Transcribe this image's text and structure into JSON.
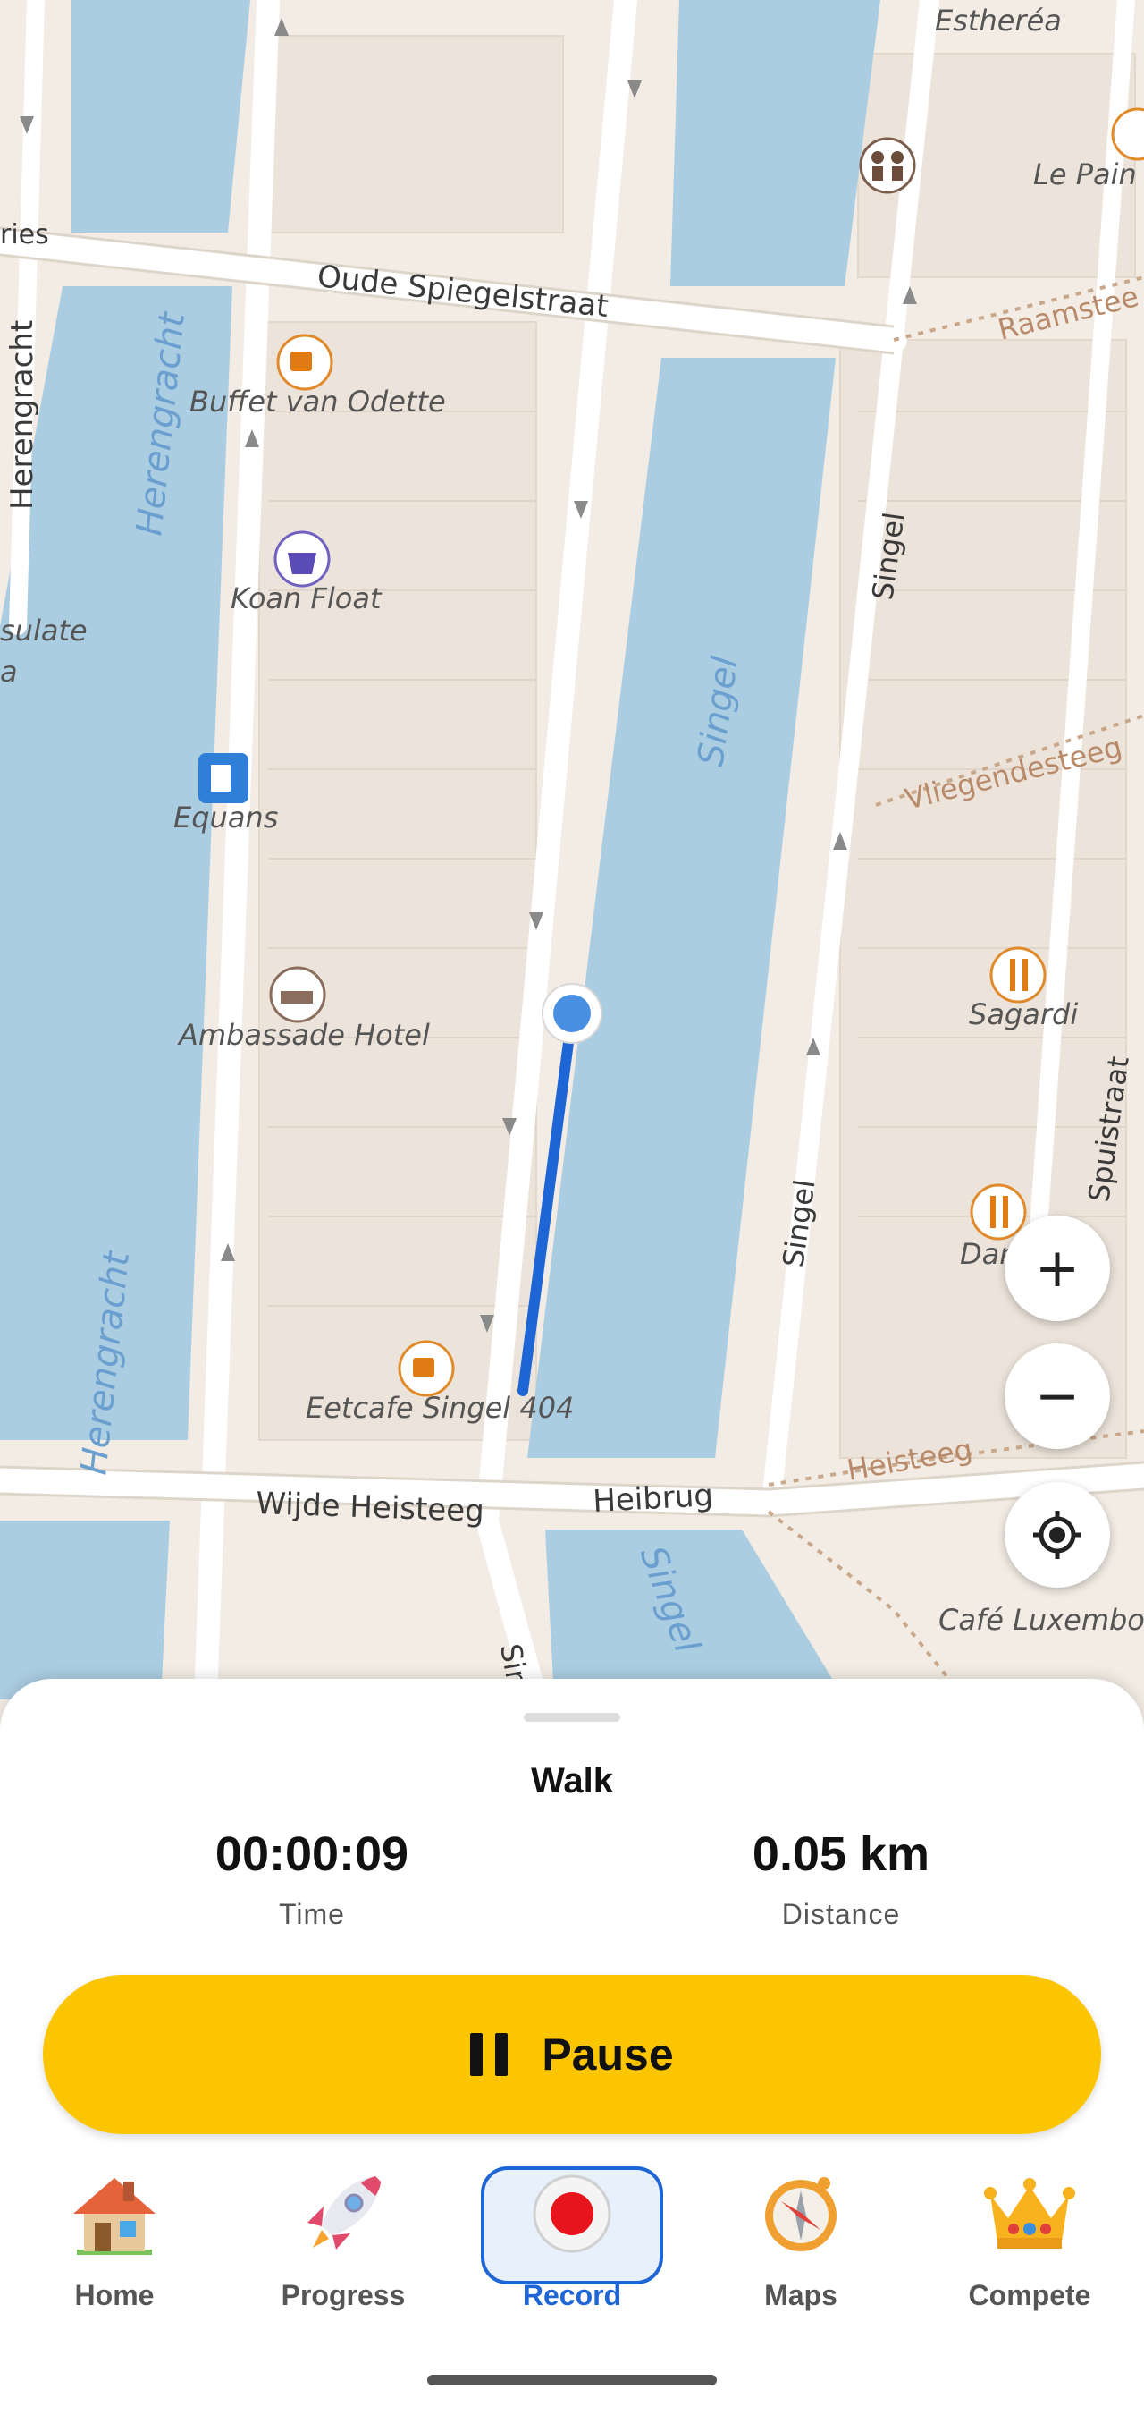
{
  "map": {
    "labels": {
      "estherea": "Estheréa",
      "le_pain": "Le Pain C",
      "ries": "ries",
      "oude_spiegelstraat": "Oude Spiegelstraat",
      "raamsteeg": "Raamstee",
      "herengracht_left": "Herengracht",
      "herengracht_canal": "Herengracht",
      "herengracht_canal_2": "Herengracht",
      "buffet": "Buffet van Odette",
      "koan": "Koan Float",
      "consulate_1": "sulate",
      "consulate_2": "a",
      "singel_canal": "Singel",
      "singel_street": "Singel",
      "singel_street_2": "Singel",
      "singel_canal_2": "Singel",
      "vliegendesteeg": "Vliegendesteeg",
      "equans": "Equans",
      "sagardi": "Sagardi",
      "ambassade": "Ambassade Hotel",
      "spuistraat": "Spuistraat",
      "dan": "Dan",
      "eetcafe": "Eetcafe Singel 404",
      "heisteeg": "Heisteeg",
      "wijde_heisteeg": "Wijde Heisteeg",
      "heibrug": "Heibrug",
      "cafe_luxembourg": "Café Luxembou",
      "sin": "Sin"
    },
    "controls": {
      "zoom_in": "+",
      "zoom_out": "−"
    }
  },
  "sheet": {
    "activity": "Walk",
    "time_value": "00:00:09",
    "time_label": "Time",
    "distance_value": "0.05 km",
    "distance_label": "Distance",
    "pause_label": "Pause"
  },
  "nav": {
    "items": [
      {
        "label": "Home",
        "icon": "house-icon"
      },
      {
        "label": "Progress",
        "icon": "rocket-icon"
      },
      {
        "label": "Record",
        "icon": "record-icon"
      },
      {
        "label": "Maps",
        "icon": "compass-icon"
      },
      {
        "label": "Compete",
        "icon": "crown-icon"
      }
    ],
    "active": "Record"
  },
  "colors": {
    "water": "#abcde2",
    "land": "#f2ece4",
    "route": "#1e66d6",
    "accent": "#fcc501",
    "active_nav": "#1e66d6"
  }
}
